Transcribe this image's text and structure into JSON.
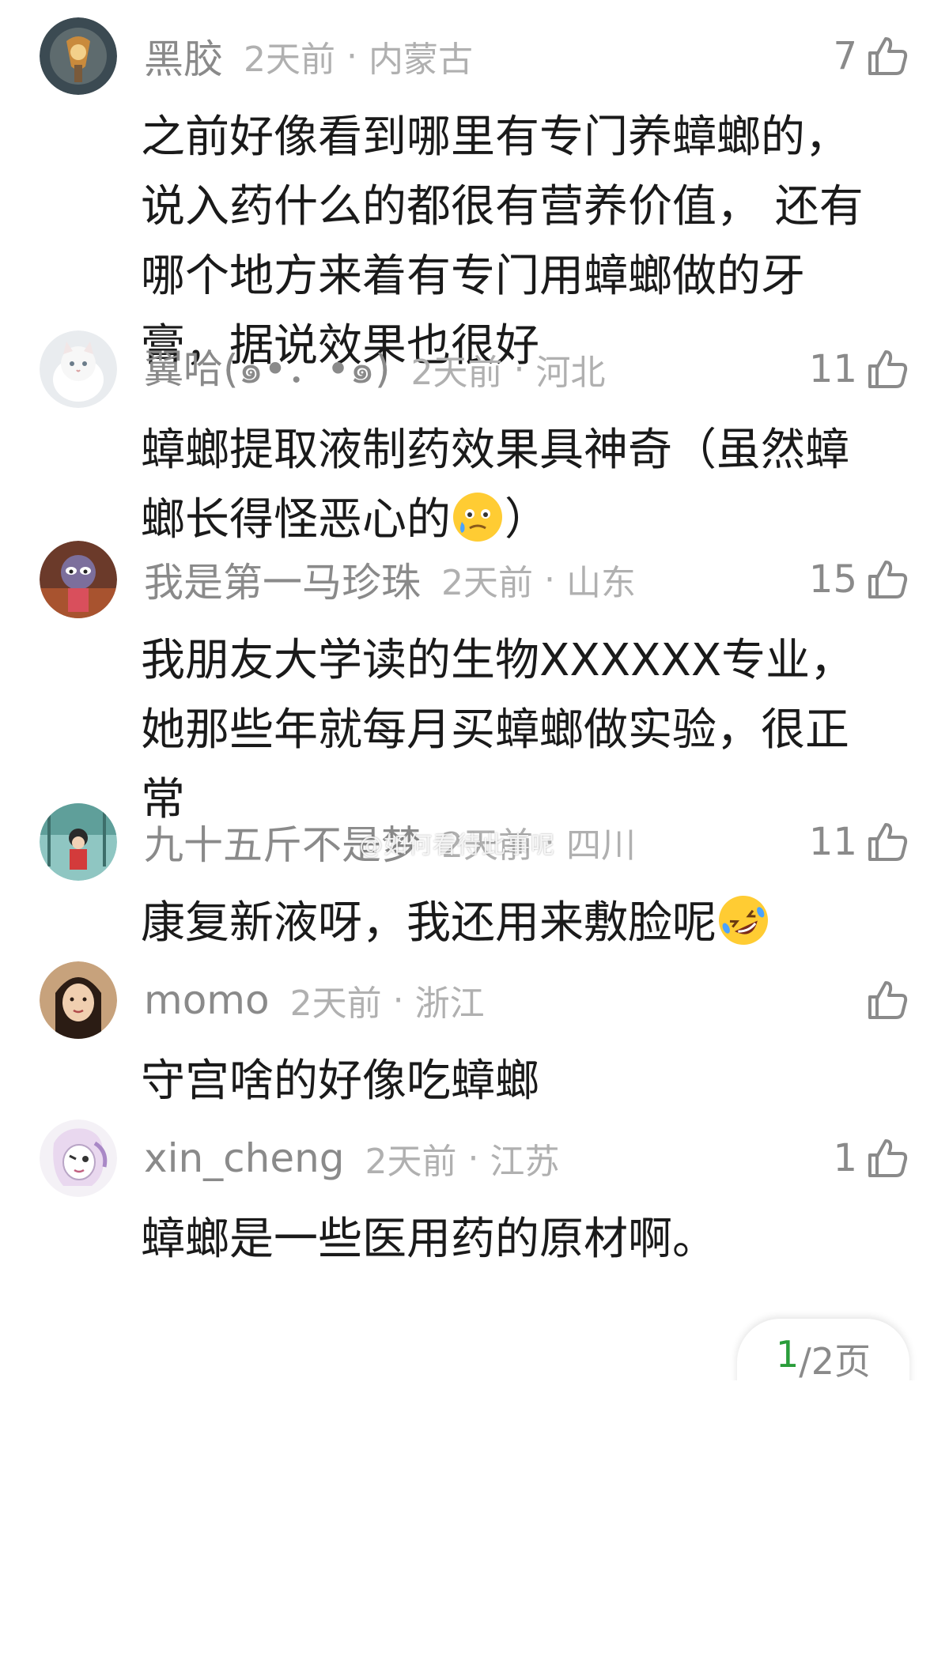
{
  "comments": [
    {
      "name": "黑胶",
      "time": "2天前",
      "location": "内蒙古",
      "likes": "7",
      "text": "之前好像看到哪里有专门养蟑螂的，说入药什么的都很有营养价值， 还有哪个地方来着有专门用蟑螂做的牙膏，据说效果也很好"
    },
    {
      "name": "翼哈(๑•．•๑)",
      "time": "2天前",
      "location": "河北",
      "likes": "11",
      "text": "蟑螂提取液制药效果具神奇（虽然蟑螂长得怪恶心的",
      "text_after": "）"
    },
    {
      "name": "我是第一马珍珠",
      "time": "2天前",
      "location": "山东",
      "likes": "15",
      "text": "我朋友大学读的生物XXXXXX专业，她那些年就每月买蟑螂做实验，很正常"
    },
    {
      "name": "九十五斤不是梦",
      "time": "2天前",
      "location": "四川",
      "likes": "11",
      "text": "康复新液呀，我还用来敷脸呢"
    },
    {
      "name": "momo",
      "time": "2天前",
      "location": "浙江",
      "likes": "",
      "text": "守宫啥的好像吃蟑螂"
    },
    {
      "name": "xin_cheng",
      "time": "2天前",
      "location": "江苏",
      "likes": "1",
      "text": "蟑螂是一些医用药的原材啊。"
    }
  ],
  "meta_separator": "·",
  "pager": {
    "current": "1",
    "rest": "/2页"
  },
  "watermark": "@如何看待此事呢",
  "icons": {
    "like": "thumbs-up-icon",
    "emoji_2": "sweat-face-emoji",
    "emoji_4": "rolling-laughing-emoji"
  },
  "colors": {
    "name": "#8a8a8a",
    "meta": "#b0b0b0",
    "text": "#1a1a1a",
    "pager_current": "#2a9d3a"
  }
}
